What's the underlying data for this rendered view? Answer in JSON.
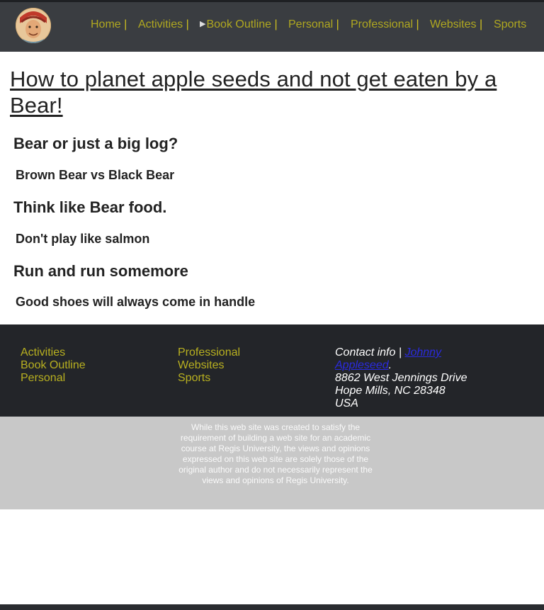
{
  "nav": {
    "items": [
      {
        "label": "Home",
        "sep": "|"
      },
      {
        "label": "Activities",
        "sep": "|"
      },
      {
        "label": "Book Outline",
        "sep": "|"
      },
      {
        "label": "Personal",
        "sep": "|"
      },
      {
        "label": "Professional",
        "sep": "|"
      },
      {
        "label": "Websites",
        "sep": "|"
      },
      {
        "label": "Sports",
        "sep": ""
      }
    ]
  },
  "main": {
    "title": "How to planet apple seeds and not get eaten by a Bear!",
    "sections": [
      {
        "heading": "Bear or just a big log?",
        "subheading": "Brown Bear vs Black Bear"
      },
      {
        "heading": "Think like Bear food.",
        "subheading": "Don't play like salmon"
      },
      {
        "heading": "Run and run somemore",
        "subheading": "Good shoes will always come in handle"
      }
    ]
  },
  "footer": {
    "col1": [
      "Activities",
      "Book Outline",
      "Personal"
    ],
    "col2": [
      "Professional",
      "Websites",
      "Sports"
    ],
    "contact": {
      "label": "Contact info |",
      "link": "Johnny Appleseed",
      "after": ".",
      "address1": "8862 West Jennings Drive",
      "address2": "Hope Mills, NC 28348",
      "country": "USA"
    }
  },
  "disclaimer": "While this web site was created to satisfy the requirement of building a web site for an academic course at Regis University, the views and opinions expressed on this web site are solely those of the original author and do not necessarily represent the views and opinions of Regis University."
}
